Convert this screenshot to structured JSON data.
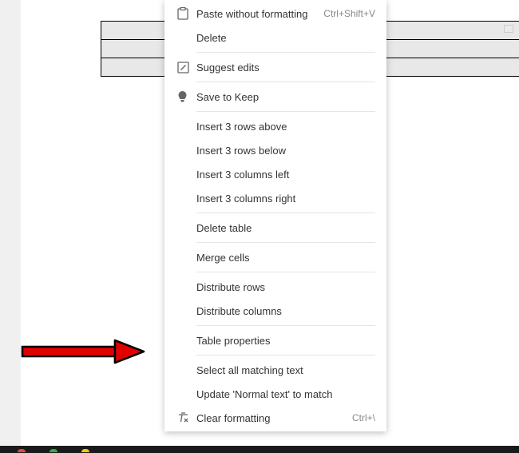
{
  "menu": {
    "paste_without_formatting": {
      "label": "Paste without formatting",
      "shortcut": "Ctrl+Shift+V"
    },
    "delete": {
      "label": "Delete"
    },
    "suggest_edits": {
      "label": "Suggest edits"
    },
    "save_to_keep": {
      "label": "Save to Keep"
    },
    "insert_rows_above": {
      "label": "Insert 3 rows above"
    },
    "insert_rows_below": {
      "label": "Insert 3 rows below"
    },
    "insert_cols_left": {
      "label": "Insert 3 columns left"
    },
    "insert_cols_right": {
      "label": "Insert 3 columns right"
    },
    "delete_table": {
      "label": "Delete table"
    },
    "merge_cells": {
      "label": "Merge cells"
    },
    "distribute_rows": {
      "label": "Distribute rows"
    },
    "distribute_columns": {
      "label": "Distribute columns"
    },
    "table_properties": {
      "label": "Table properties"
    },
    "select_matching": {
      "label": "Select all matching text"
    },
    "update_normal": {
      "label": "Update 'Normal text' to match"
    },
    "clear_formatting": {
      "label": "Clear formatting",
      "shortcut": "Ctrl+\\"
    }
  },
  "table": {
    "rows": 3,
    "cols": 1
  }
}
